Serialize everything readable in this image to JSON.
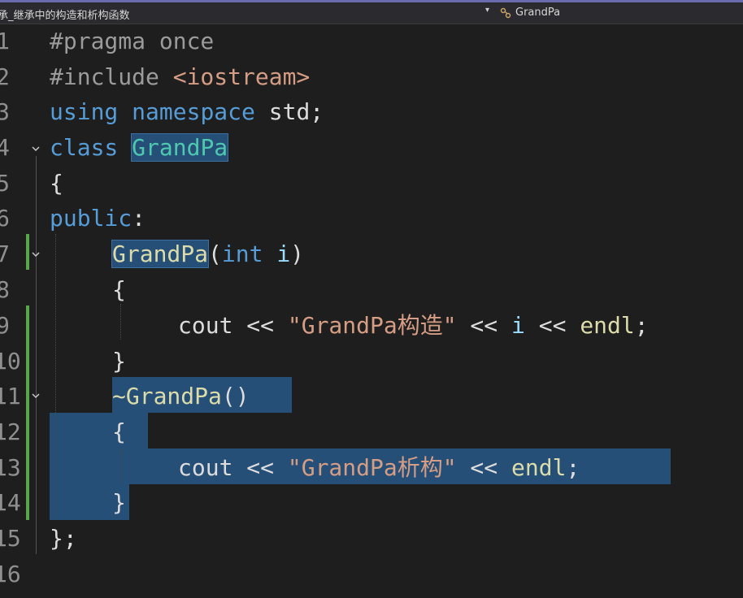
{
  "navbar": {
    "file_label": "承_继承中的构造和析构函数",
    "dropdown_glyph": "▾",
    "class_label": "GrandPa"
  },
  "line_numbers": [
    "1",
    "2",
    "3",
    "4",
    "5",
    "6",
    "7",
    "8",
    "9",
    "10",
    "11",
    "12",
    "13",
    "14",
    "15",
    "16"
  ],
  "code": {
    "l1": {
      "a": "#pragma once"
    },
    "l2": {
      "a": "#include ",
      "b": "<iostream>"
    },
    "l3": {
      "a": "using",
      "b": " ",
      "c": "namespace",
      "d": " std;"
    },
    "l4": {
      "a": "class",
      "b": " ",
      "c": "GrandPa"
    },
    "l5": {
      "a": "{"
    },
    "l6": {
      "a": "public",
      ":": ":"
    },
    "l7": {
      "a": "GrandPa",
      "b": "(",
      "c": "int",
      "d": " ",
      "e": "i",
      "f": ")"
    },
    "l8": {
      "a": "{"
    },
    "l9": {
      "a": "cout << ",
      "b": "\"GrandPa构造\"",
      "c": " << ",
      "d": "i",
      "e": " << ",
      "f": "endl",
      "g": ";"
    },
    "l10": {
      "a": "}"
    },
    "l11": {
      "a": "~GrandPa",
      "b": "()"
    },
    "l12": {
      "a": "{"
    },
    "l13": {
      "a": "cout << ",
      "b": "\"GrandPa析构\"",
      "c": " << ",
      "d": "endl",
      "e": ";"
    },
    "l14": {
      "a": "}"
    },
    "l15": {
      "a": "};"
    }
  },
  "colors": {
    "background": "#1e1e1e",
    "keyword": "#569cd6",
    "type": "#4ec9b0",
    "string": "#d69d85",
    "function": "#dcdcaa",
    "selection": "#264f78",
    "change_marker": "#57a64a"
  },
  "icons": {
    "navbar_class": "class-icon",
    "fold": "chevron-down-icon"
  }
}
